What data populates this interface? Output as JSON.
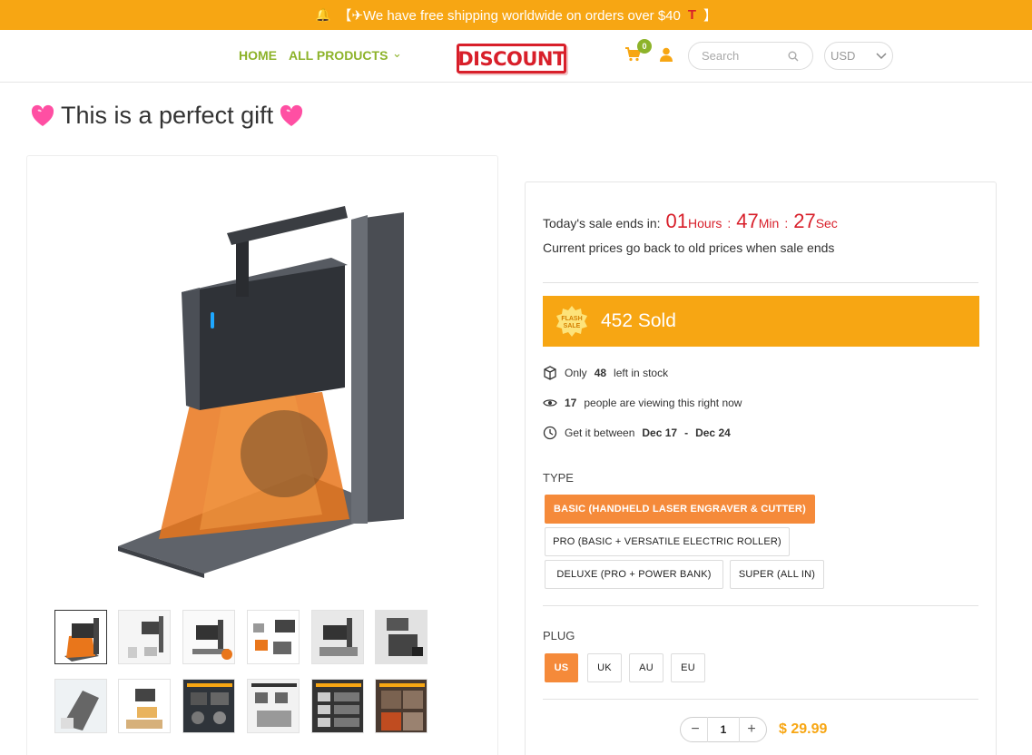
{
  "announcement": {
    "icon": "bell-icon",
    "text": "【✈We have free shipping worldwide on orders over $40",
    "suffix_icon": "gift-icon",
    "close_bracket": "】"
  },
  "header": {
    "nav": [
      {
        "label": "HOME"
      },
      {
        "label": "ALL PRODUCTS"
      }
    ],
    "logo_text": "DISCOUNT",
    "cart_count": "0",
    "search_placeholder": "Search",
    "currency": "USD",
    "accent_color": "#8db32a"
  },
  "product": {
    "title": "This is a perfect gift",
    "sale_label": "Today's sale ends in:",
    "hours": "01",
    "hours_unit": "Hours",
    "minutes": "47",
    "minutes_unit": "Min",
    "seconds": "27",
    "seconds_unit": "Sec",
    "sale_sub": "Current prices go back to old prices when sale ends",
    "flash_badge_text": "FLASH SALE",
    "sold_text": "452 Sold",
    "stock_prefix": "Only",
    "stock_count": "48",
    "stock_suffix": "left in stock",
    "viewers_count": "17",
    "viewers_suffix": "people are viewing this right now",
    "delivery_prefix": "Get it between",
    "delivery_start": "Dec 17",
    "delivery_sep": "-",
    "delivery_end": "Dec 24",
    "type_label": "TYPE",
    "types": [
      "BASIC (HANDHELD LASER ENGRAVER & CUTTER)",
      "PRO (BASIC + VERSATILE ELECTRIC ROLLER)",
      "DELUXE (PRO + POWER BANK)",
      "SUPER (ALL IN)"
    ],
    "plug_label": "PLUG",
    "plugs": [
      "US",
      "UK",
      "AU",
      "EU"
    ],
    "quantity": "1",
    "price": "$ 29.99",
    "brand_color": "#f7a613",
    "selected_color": "#f58a3a",
    "countdown_color": "#d81f2a"
  }
}
